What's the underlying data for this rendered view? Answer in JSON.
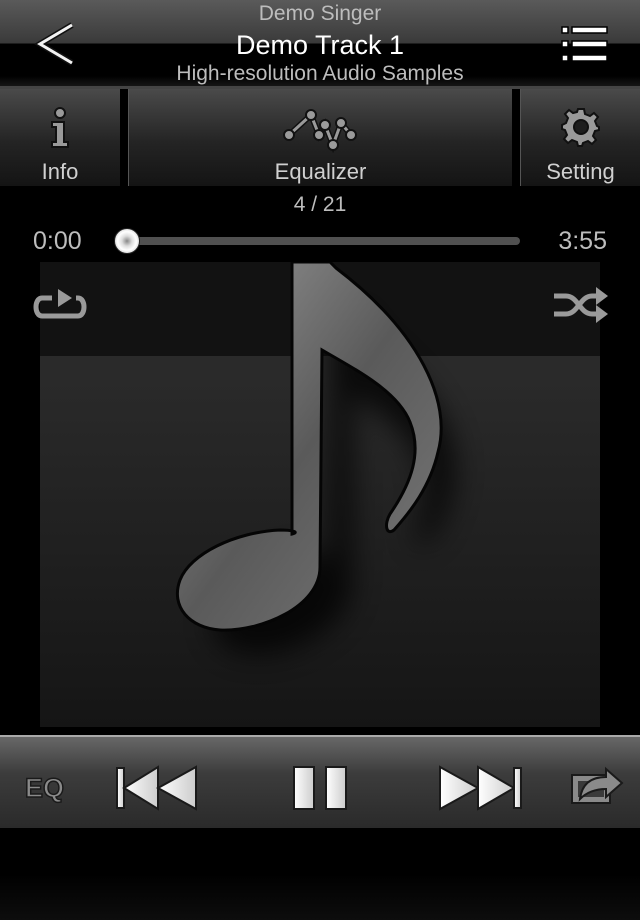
{
  "header": {
    "artist": "Demo Singer",
    "track_title": "Demo Track 1",
    "album": "High-resolution Audio Samples",
    "back_icon": "chevron-left-icon",
    "playlist_icon": "list-icon"
  },
  "tabs": [
    {
      "label": "Info",
      "icon": "info-icon"
    },
    {
      "label": "Equalizer",
      "icon": "equalizer-wave-icon"
    },
    {
      "label": "Setting",
      "icon": "gear-icon"
    }
  ],
  "track_counter": "4 / 21",
  "progress": {
    "current_time": "0:00",
    "total_time": "3:55",
    "fraction": 0.0
  },
  "artwork": {
    "icon": "music-note-icon",
    "repeat_icon": "repeat-icon",
    "shuffle_icon": "shuffle-icon"
  },
  "controls": {
    "eq_label": "EQ",
    "prev_icon": "skip-previous-icon",
    "pause_icon": "pause-icon",
    "next_icon": "skip-next-icon",
    "share_icon": "share-icon"
  }
}
